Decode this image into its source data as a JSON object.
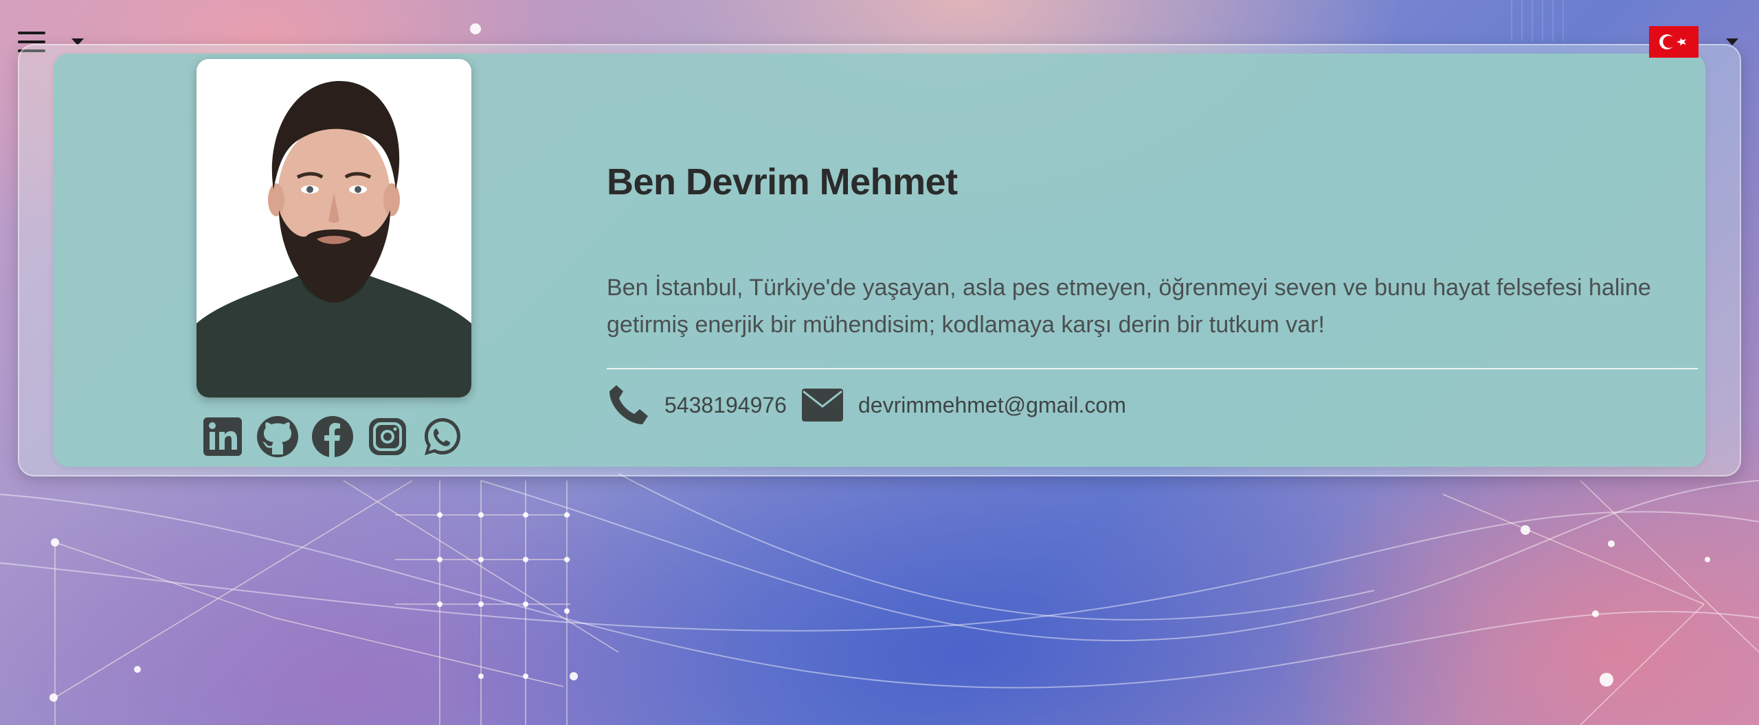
{
  "header": {
    "menu_icon": "hamburger-icon",
    "language_flag": "turkey-flag",
    "flag_color": "#e30a17"
  },
  "profile": {
    "name": "Ben Devrim Mehmet",
    "bio": "Ben İstanbul, Türkiye'de yaşayan, asla pes etmeyen, öğrenmeyi seven ve bunu hayat felsefesi haline getirmiş enerjik bir mühendisim; kodlamaya karşı derin bir tutkum var!",
    "phone": "5438194976",
    "email": "devrimmehmet@gmail.com"
  },
  "socials": [
    {
      "icon": "linkedin-icon"
    },
    {
      "icon": "github-icon"
    },
    {
      "icon": "facebook-icon"
    },
    {
      "icon": "instagram-icon"
    },
    {
      "icon": "whatsapp-icon"
    }
  ],
  "colors": {
    "card": "#96c9c6",
    "icon": "#3c4242",
    "title": "#2b2b2b"
  }
}
